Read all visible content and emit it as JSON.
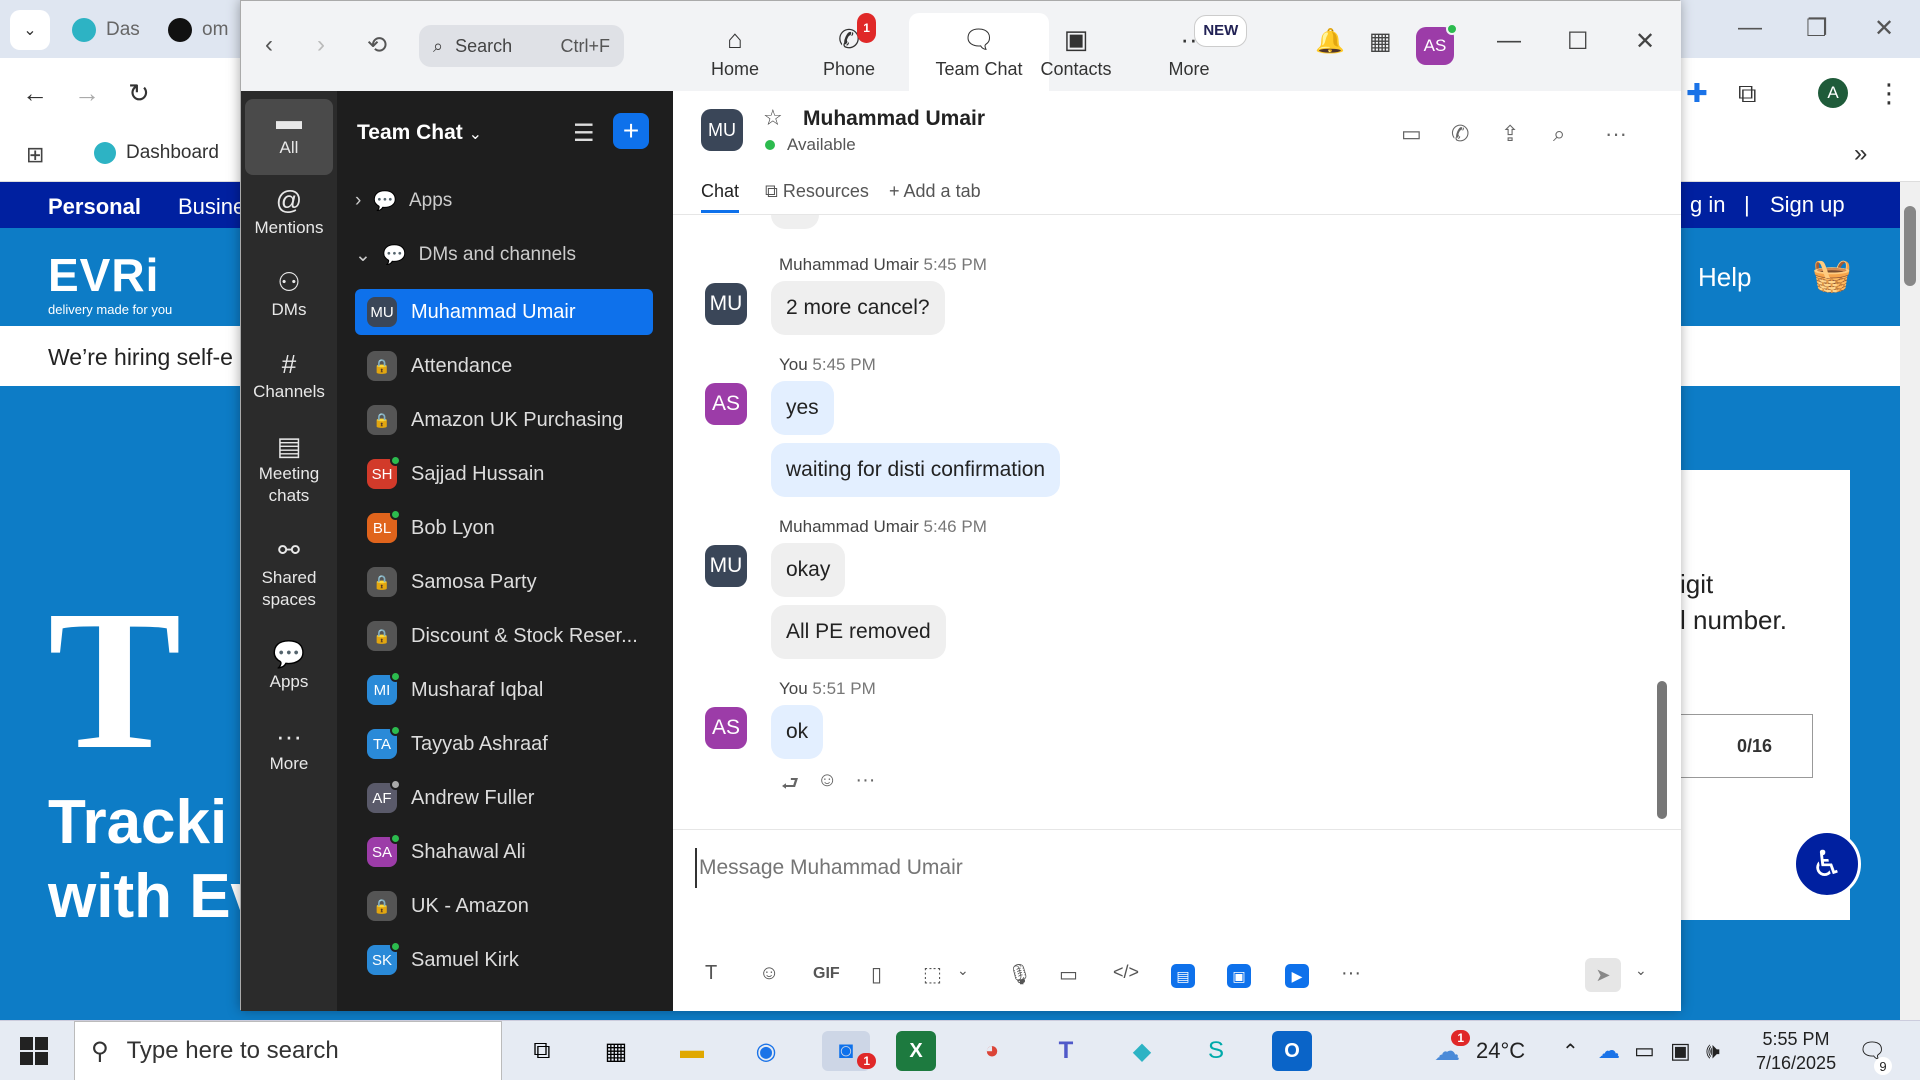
{
  "browser": {
    "tabs": [
      "Das",
      "om"
    ],
    "bookmark": "Dashboard",
    "nav": {
      "personal": "Personal",
      "business": "Busine",
      "login": "g in",
      "signup": "Sign up"
    },
    "brand": {
      "logo": "EVRi",
      "tagline": "delivery made for you"
    },
    "help": "Help",
    "hiring": "We’re hiring self-e",
    "hero_letter": "T",
    "hero_text_1": "Tracki",
    "hero_text_2": "with Ev",
    "card_text_1": "igit",
    "card_text_2": "l number.",
    "counter": "0/16"
  },
  "zoom": {
    "search": {
      "placeholder": "Search",
      "shortcut": "Ctrl+F"
    },
    "tabs": [
      {
        "label": "Home",
        "icon": "home-icon"
      },
      {
        "label": "Phone",
        "icon": "phone-icon",
        "badge": "1"
      },
      {
        "label": "Team Chat",
        "icon": "chat-icon"
      },
      {
        "label": "Contacts",
        "icon": "contacts-icon"
      },
      {
        "label": "More",
        "icon": "more-icon",
        "badge": "NEW"
      }
    ],
    "avatar": "AS",
    "rail": [
      {
        "label": "All",
        "icon": "chat-bubble-icon"
      },
      {
        "label": "Mentions",
        "icon": "at-icon"
      },
      {
        "label": "DMs",
        "icon": "people-icon"
      },
      {
        "label": "Channels",
        "icon": "hash-icon"
      },
      {
        "label": "Meeting chats",
        "icon": "calendar-icon"
      },
      {
        "label": "Shared spaces",
        "icon": "share-icon"
      },
      {
        "label": "Apps",
        "icon": "apps-icon"
      },
      {
        "label": "More",
        "icon": "ellipsis-icon"
      }
    ],
    "sidebar": {
      "title": "Team Chat",
      "apps_section": "Apps",
      "dm_section": "DMs and channels",
      "items": [
        {
          "name": "Muhammad Umair",
          "initials": "MU",
          "color": "#3a4658",
          "type": "dm"
        },
        {
          "name": "Attendance",
          "type": "channel"
        },
        {
          "name": "Amazon UK Purchasing",
          "type": "channel"
        },
        {
          "name": "Sajjad Hussain",
          "initials": "SH",
          "color": "#d23a2a",
          "type": "dm"
        },
        {
          "name": "Bob Lyon",
          "initials": "BL",
          "color": "#e0641c",
          "type": "dm"
        },
        {
          "name": "Samosa Party",
          "type": "channel"
        },
        {
          "name": "Discount & Stock Reser...",
          "type": "channel"
        },
        {
          "name": "Musharaf Iqbal",
          "initials": "MI",
          "color": "#2a8ad8",
          "type": "dm"
        },
        {
          "name": "Tayyab Ashraaf",
          "initials": "TA",
          "color": "#2a8ad8",
          "type": "dm"
        },
        {
          "name": "Andrew Fuller",
          "initials": "AF",
          "color": "#5a5a6a",
          "type": "dm"
        },
        {
          "name": "Shahawal Ali",
          "initials": "SA",
          "color": "#9c3ca8",
          "type": "dm"
        },
        {
          "name": "UK - Amazon",
          "type": "channel"
        },
        {
          "name": "Samuel Kirk",
          "initials": "SK",
          "color": "#2a8ad8",
          "type": "dm"
        }
      ]
    },
    "chat": {
      "name": "Muhammad Umair",
      "initials": "MU",
      "status": "Available",
      "tabs": [
        "Chat",
        "Resources",
        "Add a tab"
      ],
      "messages": [
        {
          "sender": "Muhammad Umair",
          "time": "5:45 PM",
          "initials": "MU",
          "texts": [
            "2 more cancel?"
          ]
        },
        {
          "sender": "You",
          "time": "5:45 PM",
          "initials": "AS",
          "texts": [
            "yes",
            "waiting for disti confirmation"
          ]
        },
        {
          "sender": "Muhammad Umair",
          "time": "5:46 PM",
          "initials": "MU",
          "texts": [
            "okay",
            "All PE removed"
          ]
        },
        {
          "sender": "You",
          "time": "5:51 PM",
          "initials": "AS",
          "texts": [
            "ok"
          ]
        }
      ],
      "compose_placeholder": "Message Muhammad Umair",
      "gif_label": "GIF"
    }
  },
  "taskbar": {
    "search_placeholder": "Type here to search",
    "weather": "24°C",
    "time": "5:55 PM",
    "date": "7/16/2025",
    "notif_count": "9",
    "zoom_badge": "1",
    "weather_badge": "1"
  }
}
